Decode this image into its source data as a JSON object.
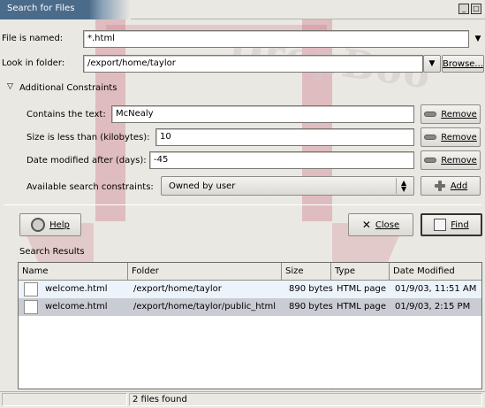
{
  "window": {
    "title": "Search for Files"
  },
  "main": {
    "file_named": {
      "label": "File is named:",
      "value": "*.html"
    },
    "look_in": {
      "label": "Look in folder:",
      "value": "/export/home/taylor",
      "browse_label": "Browse..."
    },
    "additional": {
      "label": "Additional Constraints"
    },
    "constraints": [
      {
        "label": "Contains the text:",
        "value": "McNealy",
        "remove_label": "Remove"
      },
      {
        "label": "Size is less than (kilobytes):",
        "value": "10",
        "remove_label": "Remove"
      },
      {
        "label": "Date modified after (days):",
        "value": "-45",
        "remove_label": "Remove"
      }
    ],
    "available": {
      "label": "Available search constraints:",
      "selected": "Owned by user",
      "add_label": "Add"
    }
  },
  "buttons": {
    "help": "Help",
    "close": "Close",
    "find": "Find"
  },
  "results": {
    "label": "Search Results",
    "columns": [
      "Name",
      "Folder",
      "Size",
      "Type",
      "Date Modified"
    ],
    "rows": [
      {
        "name": "welcome.html",
        "folder": "/export/home/taylor",
        "size": "890 bytes",
        "type": "HTML page",
        "modified": "01/9/03, 11:51 AM"
      },
      {
        "name": "welcome.html",
        "folder": "/export/home/taylor/public_html",
        "size": "890 bytes",
        "type": "HTML page",
        "modified": "01/9/03, 2:15 PM"
      }
    ],
    "selected_row": 1,
    "colors": {
      "row_selected": "#c9ccd2",
      "row_alt": "#edf3fb"
    }
  },
  "status": {
    "text": "2 files found"
  },
  "watermark": {
    "text": "DropBoo",
    "color": "#c86074"
  }
}
